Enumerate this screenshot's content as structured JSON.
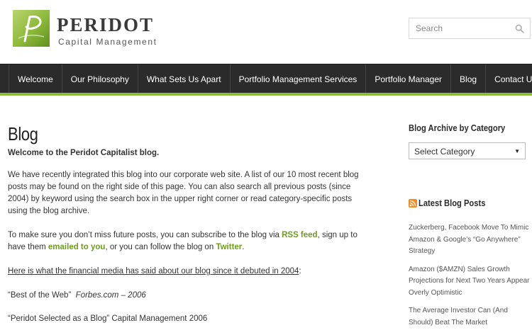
{
  "header": {
    "logo_name": "PERIDOT",
    "logo_sub": "Capital Management",
    "search_placeholder": "Search"
  },
  "nav": {
    "items": [
      "Welcome",
      "Our Philosophy",
      "What Sets Us Apart",
      "Portfolio Management Services",
      "Portfolio Manager",
      "Blog",
      "Contact Us"
    ]
  },
  "main": {
    "title": "Blog",
    "welcome": "Welcome to the Peridot Capitalist blog.",
    "intro": "We have recently integrated this blog into our corporate web site. A list of our 10 most recent blog posts may be found on the right side of this page. You can also search all previous posts (since 2004) by keyword using the search box in the upper right corner or read category-specific posts using the blog archive.",
    "subscribe_prefix": "To make sure you don’t miss future posts, you can subscribe to the blog via ",
    "rss_link": "RSS feed",
    "subscribe_mid": ", sign up to have them ",
    "email_link": "emailed to you",
    "subscribe_mid2": ", or you can follow the blog on ",
    "twitter_link": "Twitter",
    "subscribe_end": ".",
    "media_heading": "Here is what the financial media has said about our blog since it debuted in 2004",
    "media_colon": ":",
    "quote1_text": "“Best of the Web”",
    "quote1_source": "Forbes.com – 2006",
    "quote2_text": "“Peridot Selected as a Blog”  Capital Management 2006"
  },
  "sidebar": {
    "archive_title": "Blog Archive by Category",
    "select_value": "Select Category",
    "latest_title": "Latest Blog Posts",
    "posts": [
      "Zuckerberg, Facebook Move To Mimic Amazon & Google’s “Go Anywhere” Strategy",
      "Amazon ($AMZN) Sales Growth Projections for Next Two Years Appear Overly Optimistic",
      "The Average Investor Can (And Should) Beat The Market"
    ]
  },
  "colors": {
    "nav_bg": "#2b2b2b",
    "accent_green": "#8cbc3f",
    "link_green": "#6e9b1c"
  }
}
